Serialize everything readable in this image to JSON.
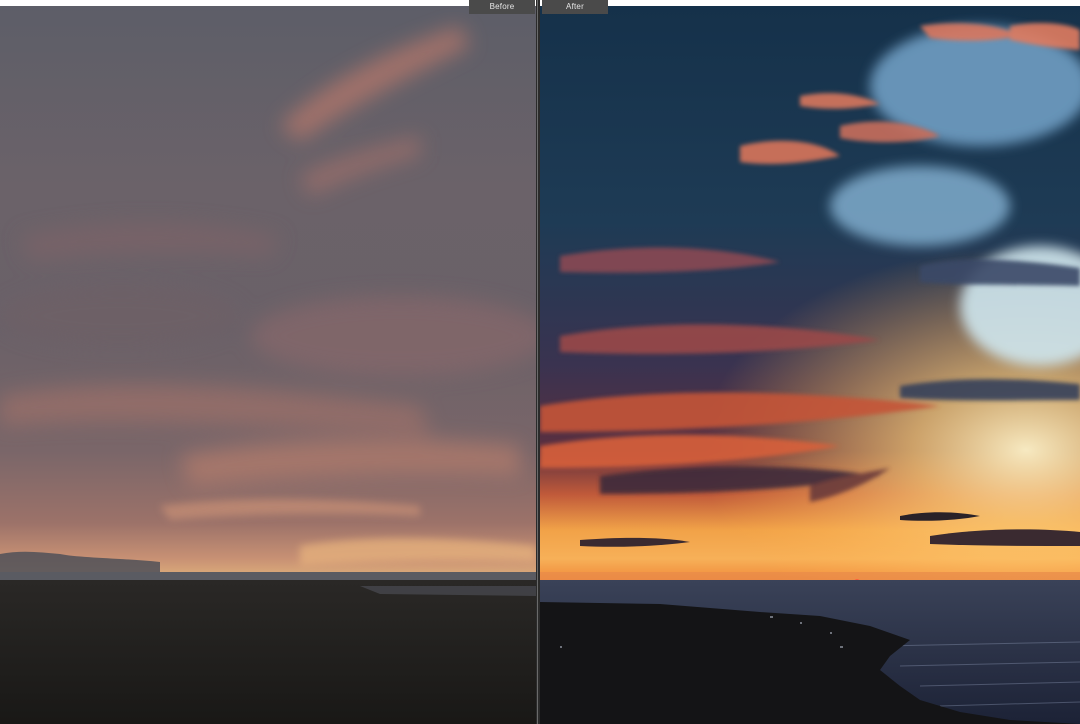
{
  "compare": {
    "before_label": "Before",
    "after_label": "After"
  },
  "colors": {
    "before_sky_top": "#5f6069",
    "before_sky_warm": "#a8766c",
    "before_horizon": "#e6b27a",
    "after_sky_deep": "#1e3a52",
    "after_cloud_orange": "#e9764a",
    "after_horizon_glow": "#ffc15a",
    "sea": "#2a3348",
    "land": "#121212"
  }
}
